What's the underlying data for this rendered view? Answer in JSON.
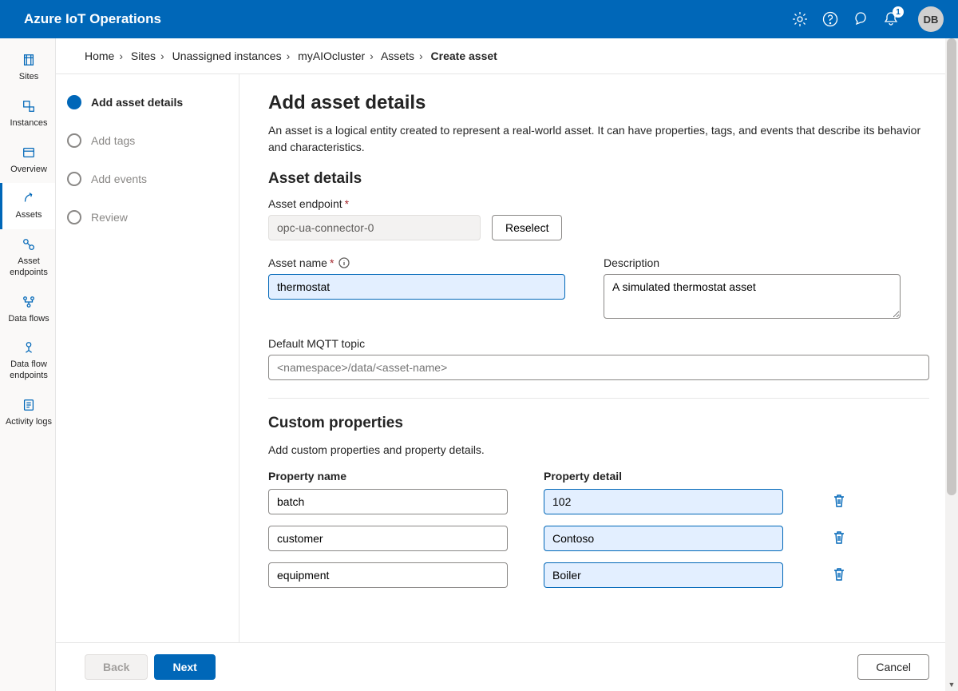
{
  "header": {
    "title": "Azure IoT Operations",
    "notifications_count": "1",
    "avatar_initials": "DB"
  },
  "rail": {
    "items": [
      {
        "id": "sites",
        "label": "Sites"
      },
      {
        "id": "instances",
        "label": "Instances"
      },
      {
        "id": "overview",
        "label": "Overview"
      },
      {
        "id": "assets",
        "label": "Assets"
      },
      {
        "id": "asset-endpoints",
        "label": "Asset endpoints"
      },
      {
        "id": "data-flows",
        "label": "Data flows"
      },
      {
        "id": "data-flow-endpoints",
        "label": "Data flow endpoints"
      },
      {
        "id": "activity-logs",
        "label": "Activity logs"
      }
    ]
  },
  "breadcrumbs": {
    "items": [
      "Home",
      "Sites",
      "Unassigned instances",
      "myAIOcluster",
      "Assets"
    ],
    "current": "Create asset"
  },
  "wizard": {
    "steps": [
      {
        "label": "Add asset details",
        "current": true
      },
      {
        "label": "Add tags",
        "current": false
      },
      {
        "label": "Add events",
        "current": false
      },
      {
        "label": "Review",
        "current": false
      }
    ]
  },
  "form": {
    "page_title": "Add asset details",
    "page_desc": "An asset is a logical entity created to represent a real-world asset. It can have properties, tags, and events that describe its behavior and characteristics.",
    "section_details_title": "Asset details",
    "endpoint_label": "Asset endpoint",
    "endpoint_value": "opc-ua-connector-0",
    "reselect_label": "Reselect",
    "name_label": "Asset name",
    "name_value": "thermostat",
    "desc_label": "Description",
    "desc_value": "A simulated thermostat asset",
    "mqtt_label": "Default MQTT topic",
    "mqtt_placeholder": "<namespace>/data/<asset-name>",
    "section_custom_title": "Custom properties",
    "section_custom_desc": "Add custom properties and property details.",
    "col_name": "Property name",
    "col_detail": "Property detail",
    "custom_props": [
      {
        "name": "batch",
        "detail": "102"
      },
      {
        "name": "customer",
        "detail": "Contoso"
      },
      {
        "name": "equipment",
        "detail": "Boiler"
      }
    ]
  },
  "footer": {
    "back": "Back",
    "next": "Next",
    "cancel": "Cancel"
  }
}
